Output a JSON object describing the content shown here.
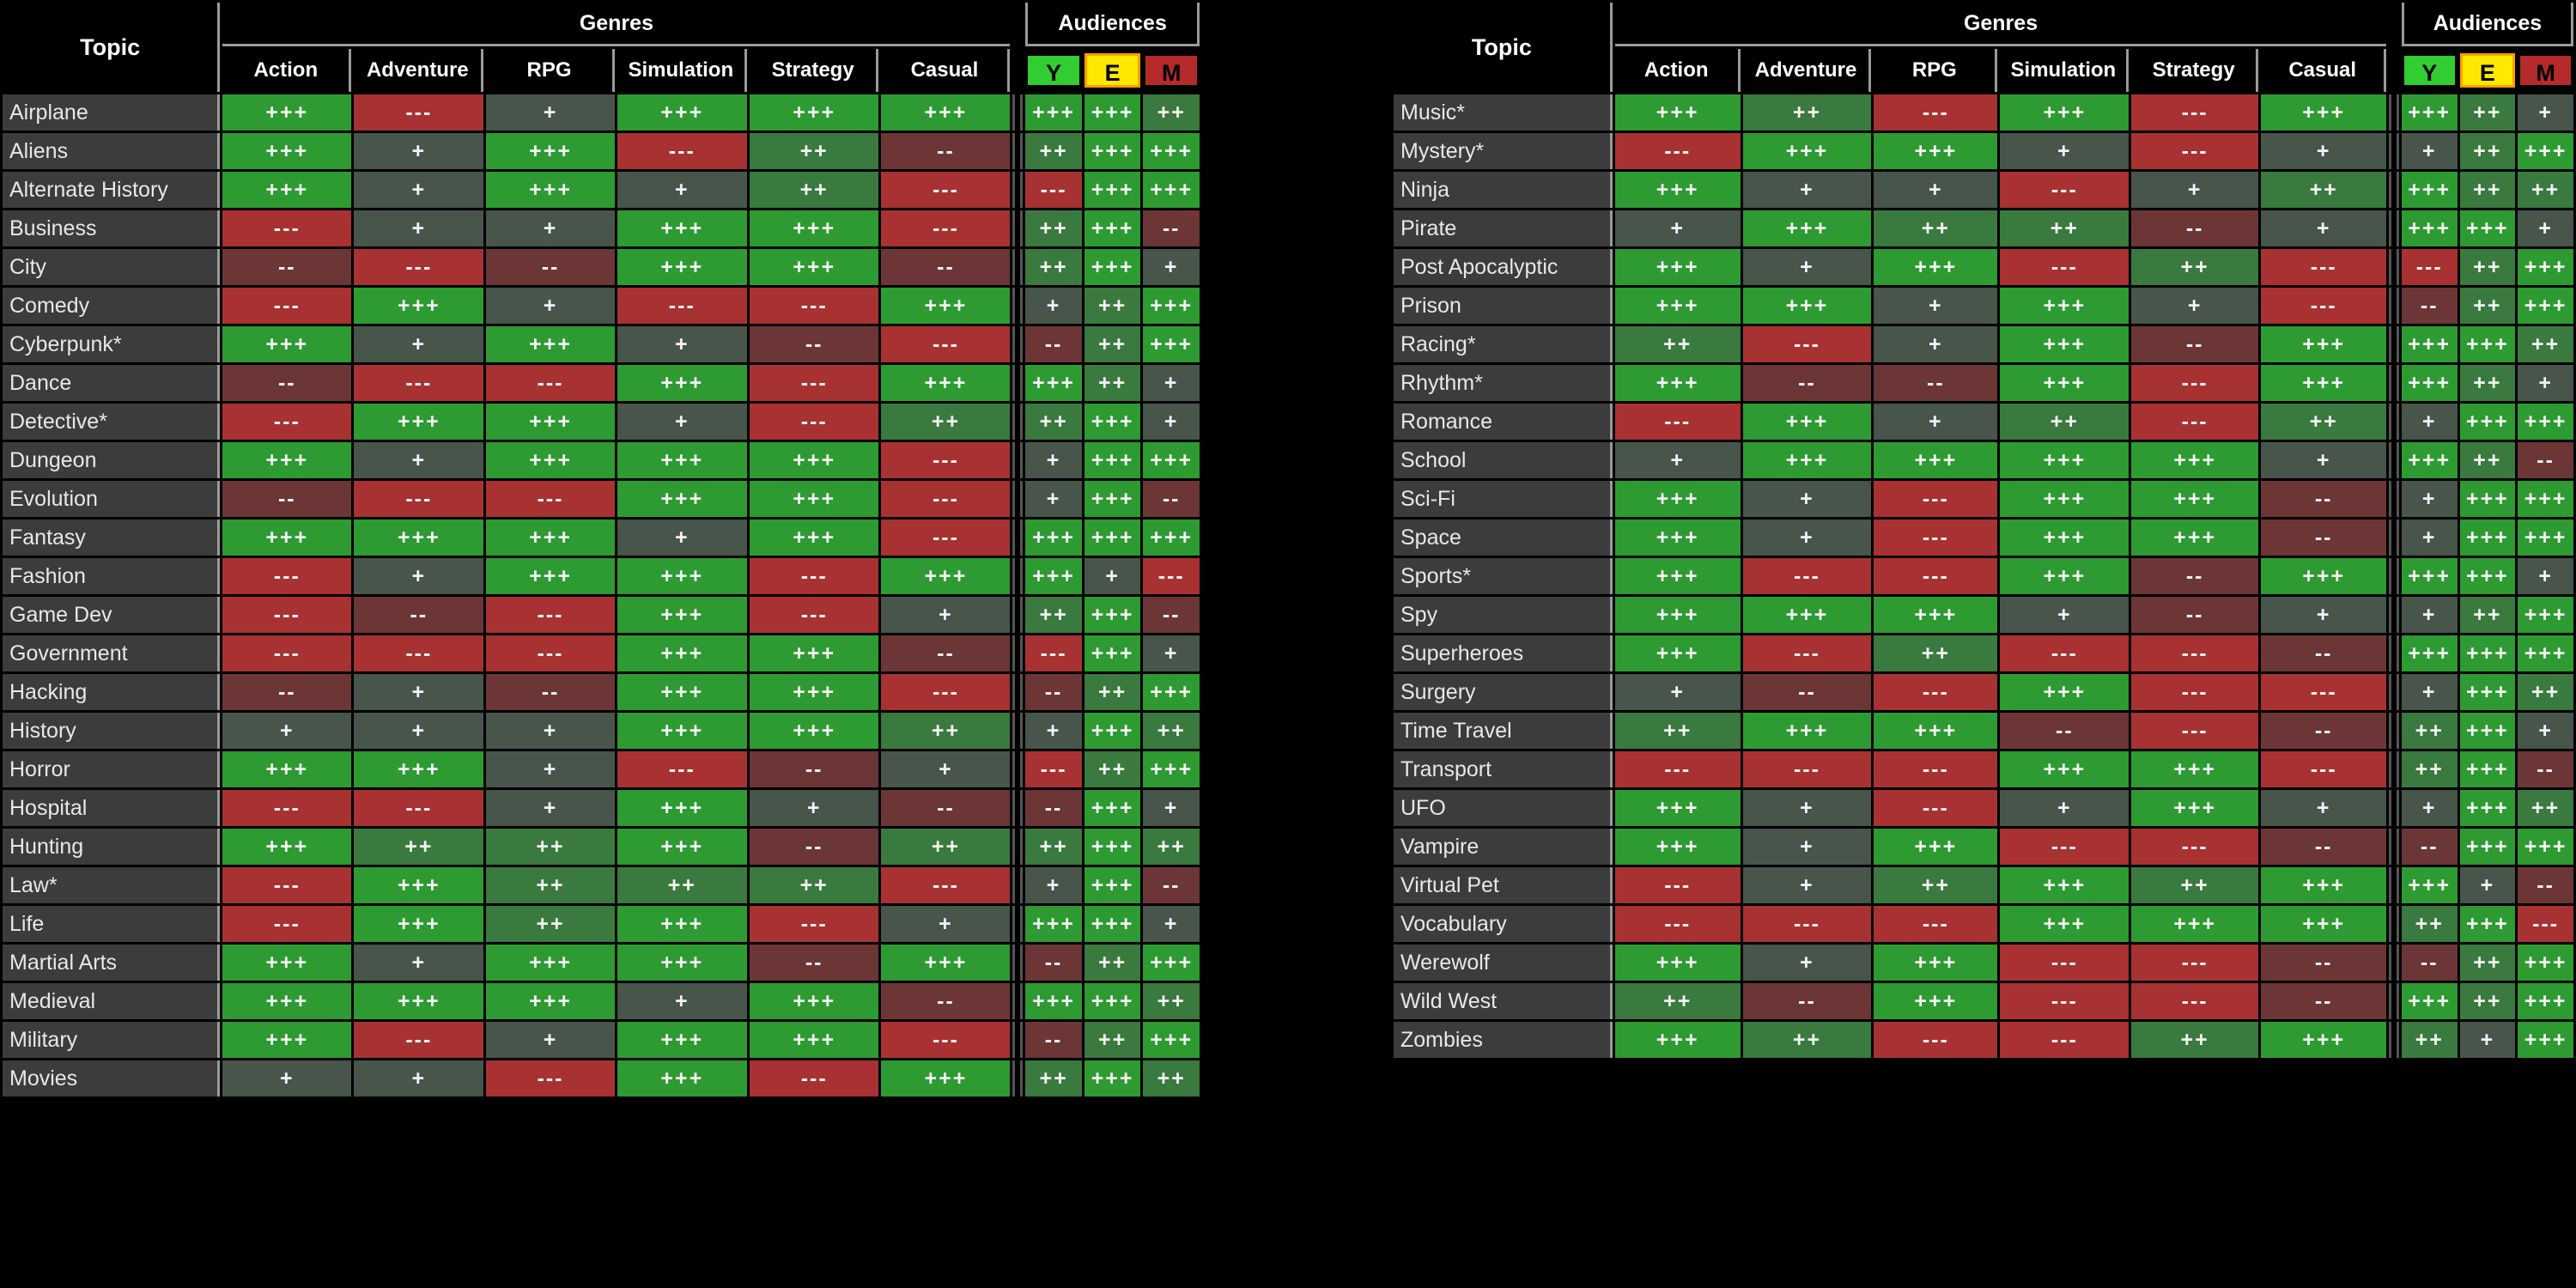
{
  "headers": {
    "topic": "Topic",
    "genres_group": "Genres",
    "audiences_group": "Audiences",
    "genres": [
      "Action",
      "Adventure",
      "RPG",
      "Simulation",
      "Strategy",
      "Casual"
    ],
    "audiences": [
      "Y",
      "E",
      "M"
    ]
  },
  "colors": {
    "background": "#000000",
    "grid": "#9a9a9a",
    "topic_cell": "#3c3c3c",
    "text": "#e8e8e8",
    "rating_plus3": "#2d9b32",
    "rating_plus2": "#3a7a3e",
    "rating_plus1": "#47554a",
    "rating_minus1": "#6d3636",
    "rating_minus3": "#a83232",
    "audience_y": "#32cd32",
    "audience_e": "#ffe800",
    "audience_e_border": "#ff9e00",
    "audience_m": "#b52a2a"
  },
  "symbols": {
    "great": "+++",
    "good": "++",
    "ok": "+",
    "poor": "--",
    "bad": "---"
  },
  "left_table": {
    "rows": [
      {
        "topic": "Airplane",
        "genres": [
          "+++",
          "---",
          "+",
          "+++",
          "+++",
          "+++"
        ],
        "audiences": [
          "+++",
          "+++",
          "++"
        ]
      },
      {
        "topic": "Aliens",
        "genres": [
          "+++",
          "+",
          "+++",
          "---",
          "++",
          "--"
        ],
        "audiences": [
          "++",
          "+++",
          "+++"
        ]
      },
      {
        "topic": "Alternate History",
        "genres": [
          "+++",
          "+",
          "+++",
          "+",
          "++",
          "---"
        ],
        "audiences": [
          "---",
          "+++",
          "+++"
        ]
      },
      {
        "topic": "Business",
        "genres": [
          "---",
          "+",
          "+",
          "+++",
          "+++",
          "---"
        ],
        "audiences": [
          "++",
          "+++",
          "--"
        ]
      },
      {
        "topic": "City",
        "genres": [
          "--",
          "---",
          "--",
          "+++",
          "+++",
          "--"
        ],
        "audiences": [
          "++",
          "+++",
          "+"
        ]
      },
      {
        "topic": "Comedy",
        "genres": [
          "---",
          "+++",
          "+",
          "---",
          "---",
          "+++"
        ],
        "audiences": [
          "+",
          "++",
          "+++"
        ]
      },
      {
        "topic": "Cyberpunk*",
        "genres": [
          "+++",
          "+",
          "+++",
          "+",
          "--",
          "---"
        ],
        "audiences": [
          "--",
          "++",
          "+++"
        ]
      },
      {
        "topic": "Dance",
        "genres": [
          "--",
          "---",
          "---",
          "+++",
          "---",
          "+++"
        ],
        "audiences": [
          "+++",
          "++",
          "+"
        ]
      },
      {
        "topic": "Detective*",
        "genres": [
          "---",
          "+++",
          "+++",
          "+",
          "---",
          "++"
        ],
        "audiences": [
          "++",
          "+++",
          "+"
        ]
      },
      {
        "topic": "Dungeon",
        "genres": [
          "+++",
          "+",
          "+++",
          "+++",
          "+++",
          "---"
        ],
        "audiences": [
          "+",
          "+++",
          "+++"
        ]
      },
      {
        "topic": "Evolution",
        "genres": [
          "--",
          "---",
          "---",
          "+++",
          "+++",
          "---"
        ],
        "audiences": [
          "+",
          "+++",
          "--"
        ]
      },
      {
        "topic": "Fantasy",
        "genres": [
          "+++",
          "+++",
          "+++",
          "+",
          "+++",
          "---"
        ],
        "audiences": [
          "+++",
          "+++",
          "+++"
        ]
      },
      {
        "topic": "Fashion",
        "genres": [
          "---",
          "+",
          "+++",
          "+++",
          "---",
          "+++"
        ],
        "audiences": [
          "+++",
          "+",
          "---"
        ]
      },
      {
        "topic": "Game Dev",
        "genres": [
          "---",
          "--",
          "---",
          "+++",
          "---",
          "+"
        ],
        "audiences": [
          "++",
          "+++",
          "--"
        ]
      },
      {
        "topic": "Government",
        "genres": [
          "---",
          "---",
          "---",
          "+++",
          "+++",
          "--"
        ],
        "audiences": [
          "---",
          "+++",
          "+"
        ]
      },
      {
        "topic": "Hacking",
        "genres": [
          "--",
          "+",
          "--",
          "+++",
          "+++",
          "---"
        ],
        "audiences": [
          "--",
          "++",
          "+++"
        ]
      },
      {
        "topic": "History",
        "genres": [
          "+",
          "+",
          "+",
          "+++",
          "+++",
          "++"
        ],
        "audiences": [
          "+",
          "+++",
          "++"
        ]
      },
      {
        "topic": "Horror",
        "genres": [
          "+++",
          "+++",
          "+",
          "---",
          "--",
          "+"
        ],
        "audiences": [
          "---",
          "++",
          "+++"
        ]
      },
      {
        "topic": "Hospital",
        "genres": [
          "---",
          "---",
          "+",
          "+++",
          "+",
          "--"
        ],
        "audiences": [
          "--",
          "+++",
          "+"
        ]
      },
      {
        "topic": "Hunting",
        "genres": [
          "+++",
          "++",
          "++",
          "+++",
          "--",
          "++"
        ],
        "audiences": [
          "++",
          "+++",
          "++"
        ]
      },
      {
        "topic": "Law*",
        "genres": [
          "---",
          "+++",
          "++",
          "++",
          "++",
          "---"
        ],
        "audiences": [
          "+",
          "+++",
          "--"
        ]
      },
      {
        "topic": "Life",
        "genres": [
          "---",
          "+++",
          "++",
          "+++",
          "---",
          "+"
        ],
        "audiences": [
          "+++",
          "+++",
          "+"
        ]
      },
      {
        "topic": "Martial Arts",
        "genres": [
          "+++",
          "+",
          "+++",
          "+++",
          "--",
          "+++"
        ],
        "audiences": [
          "--",
          "++",
          "+++"
        ]
      },
      {
        "topic": "Medieval",
        "genres": [
          "+++",
          "+++",
          "+++",
          "+",
          "+++",
          "--"
        ],
        "audiences": [
          "+++",
          "+++",
          "++"
        ]
      },
      {
        "topic": "Military",
        "genres": [
          "+++",
          "---",
          "+",
          "+++",
          "+++",
          "---"
        ],
        "audiences": [
          "--",
          "++",
          "+++"
        ]
      },
      {
        "topic": "Movies",
        "genres": [
          "+",
          "+",
          "---",
          "+++",
          "---",
          "+++"
        ],
        "audiences": [
          "++",
          "+++",
          "++"
        ]
      }
    ]
  },
  "right_table": {
    "rows": [
      {
        "topic": "Music*",
        "genres": [
          "+++",
          "++",
          "---",
          "+++",
          "---",
          "+++"
        ],
        "audiences": [
          "+++",
          "++",
          "+"
        ]
      },
      {
        "topic": "Mystery*",
        "genres": [
          "---",
          "+++",
          "+++",
          "+",
          "---",
          "+"
        ],
        "audiences": [
          "+",
          "++",
          "+++"
        ]
      },
      {
        "topic": "Ninja",
        "genres": [
          "+++",
          "+",
          "+",
          "---",
          "+",
          "++"
        ],
        "audiences": [
          "+++",
          "++",
          "++"
        ]
      },
      {
        "topic": "Pirate",
        "genres": [
          "+",
          "+++",
          "++",
          "++",
          "--",
          "+"
        ],
        "audiences": [
          "+++",
          "+++",
          "+"
        ]
      },
      {
        "topic": "Post Apocalyptic",
        "genres": [
          "+++",
          "+",
          "+++",
          "---",
          "++",
          "---"
        ],
        "audiences": [
          "---",
          "++",
          "+++"
        ]
      },
      {
        "topic": "Prison",
        "genres": [
          "+++",
          "+++",
          "+",
          "+++",
          "+",
          "---"
        ],
        "audiences": [
          "--",
          "++",
          "+++"
        ]
      },
      {
        "topic": "Racing*",
        "genres": [
          "++",
          "---",
          "+",
          "+++",
          "--",
          "+++"
        ],
        "audiences": [
          "+++",
          "+++",
          "++"
        ]
      },
      {
        "topic": "Rhythm*",
        "genres": [
          "+++",
          "--",
          "--",
          "+++",
          "---",
          "+++"
        ],
        "audiences": [
          "+++",
          "++",
          "+"
        ]
      },
      {
        "topic": "Romance",
        "genres": [
          "---",
          "+++",
          "+",
          "++",
          "---",
          "++"
        ],
        "audiences": [
          "+",
          "+++",
          "+++"
        ]
      },
      {
        "topic": "School",
        "genres": [
          "+",
          "+++",
          "+++",
          "+++",
          "+++",
          "+"
        ],
        "audiences": [
          "+++",
          "++",
          "--"
        ]
      },
      {
        "topic": "Sci-Fi",
        "genres": [
          "+++",
          "+",
          "---",
          "+++",
          "+++",
          "--"
        ],
        "audiences": [
          "+",
          "+++",
          "+++"
        ]
      },
      {
        "topic": "Space",
        "genres": [
          "+++",
          "+",
          "---",
          "+++",
          "+++",
          "--"
        ],
        "audiences": [
          "+",
          "+++",
          "+++"
        ]
      },
      {
        "topic": "Sports*",
        "genres": [
          "+++",
          "---",
          "---",
          "+++",
          "--",
          "+++"
        ],
        "audiences": [
          "+++",
          "+++",
          "+"
        ]
      },
      {
        "topic": "Spy",
        "genres": [
          "+++",
          "+++",
          "+++",
          "+",
          "--",
          "+"
        ],
        "audiences": [
          "+",
          "++",
          "+++"
        ]
      },
      {
        "topic": "Superheroes",
        "genres": [
          "+++",
          "---",
          "++",
          "---",
          "---",
          "--"
        ],
        "audiences": [
          "+++",
          "+++",
          "+++"
        ]
      },
      {
        "topic": "Surgery",
        "genres": [
          "+",
          "--",
          "---",
          "+++",
          "---",
          "---"
        ],
        "audiences": [
          "+",
          "+++",
          "++"
        ]
      },
      {
        "topic": "Time Travel",
        "genres": [
          "++",
          "+++",
          "+++",
          "--",
          "---",
          "--"
        ],
        "audiences": [
          "++",
          "+++",
          "+"
        ]
      },
      {
        "topic": "Transport",
        "genres": [
          "---",
          "---",
          "---",
          "+++",
          "+++",
          "---"
        ],
        "audiences": [
          "++",
          "+++",
          "--"
        ]
      },
      {
        "topic": "UFO",
        "genres": [
          "+++",
          "+",
          "---",
          "+",
          "+++",
          "+"
        ],
        "audiences": [
          "+",
          "+++",
          "++"
        ]
      },
      {
        "topic": "Vampire",
        "genres": [
          "+++",
          "+",
          "+++",
          "---",
          "---",
          "--"
        ],
        "audiences": [
          "--",
          "+++",
          "+++"
        ]
      },
      {
        "topic": "Virtual Pet",
        "genres": [
          "---",
          "+",
          "++",
          "+++",
          "++",
          "+++"
        ],
        "audiences": [
          "+++",
          "+",
          "--"
        ]
      },
      {
        "topic": "Vocabulary",
        "genres": [
          "---",
          "---",
          "---",
          "+++",
          "+++",
          "+++"
        ],
        "audiences": [
          "++",
          "+++",
          "---"
        ]
      },
      {
        "topic": "Werewolf",
        "genres": [
          "+++",
          "+",
          "+++",
          "---",
          "---",
          "--"
        ],
        "audiences": [
          "--",
          "++",
          "+++"
        ]
      },
      {
        "topic": "Wild West",
        "genres": [
          "++",
          "--",
          "+++",
          "---",
          "---",
          "--"
        ],
        "audiences": [
          "+++",
          "++",
          "+++"
        ]
      },
      {
        "topic": "Zombies",
        "genres": [
          "+++",
          "++",
          "---",
          "---",
          "++",
          "+++"
        ],
        "audiences": [
          "++",
          "+",
          "+++"
        ]
      }
    ]
  }
}
